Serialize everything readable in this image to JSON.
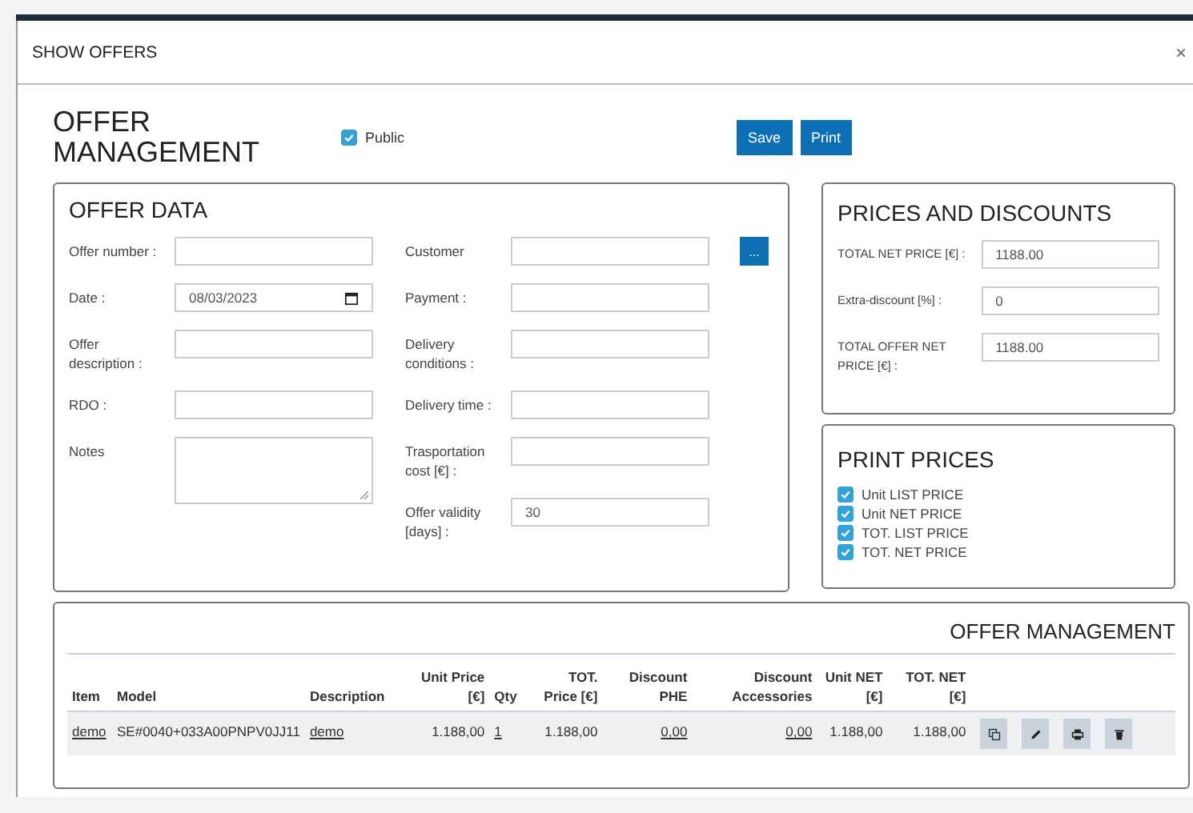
{
  "dialog": {
    "title": "SHOW OFFERS",
    "close": "×"
  },
  "header": {
    "title": "OFFER MANAGEMENT",
    "public": {
      "label": "Public",
      "checked": true
    },
    "buttons": [
      "Save",
      "Print"
    ]
  },
  "offer_data": {
    "title": "OFFER DATA",
    "customer_button": "...",
    "left_fields": [
      {
        "label": "Offer number :",
        "kind": "text"
      },
      {
        "label": "Date :",
        "kind": "date",
        "value": "08/03/2023"
      },
      {
        "label": "Offer description :",
        "kind": "text"
      },
      {
        "label": "RDO :",
        "kind": "text"
      },
      {
        "label": "Notes",
        "kind": "textarea"
      }
    ],
    "right_fields": [
      {
        "label": "Customer",
        "kind": "text"
      },
      {
        "label": "Payment :",
        "kind": "text"
      },
      {
        "label": "Delivery conditions :",
        "kind": "text"
      },
      {
        "label": "Delivery time :",
        "kind": "text"
      },
      {
        "label": "Trasportation cost [€] :",
        "kind": "text"
      },
      {
        "label": "Offer validity [days] :",
        "kind": "text",
        "value": "30"
      }
    ]
  },
  "prices": {
    "title": "PRICES AND DISCOUNTS",
    "fields": [
      {
        "label": "TOTAL NET PRICE [€] :",
        "value": "1188.00"
      },
      {
        "label": "Extra-discount [%] :",
        "value": "0"
      },
      {
        "label": "TOTAL OFFER NET PRICE [€] :",
        "value": "1188.00"
      }
    ]
  },
  "print_prices": {
    "title": "PRINT PRICES",
    "options": [
      {
        "label": "Unit LIST PRICE",
        "checked": true
      },
      {
        "label": "Unit NET PRICE",
        "checked": true
      },
      {
        "label": "TOT. LIST PRICE",
        "checked": true
      },
      {
        "label": "TOT. NET PRICE",
        "checked": true
      }
    ]
  },
  "table": {
    "title": "OFFER MANAGEMENT",
    "columns": [
      "Item",
      "Model",
      "Description",
      "Unit Price [€]",
      "Qty",
      "TOT. Price [€]",
      "Discount PHE",
      "Discount Accessories",
      "Unit NET [€]",
      "TOT. NET [€]"
    ],
    "rows": [
      {
        "cells": [
          {
            "text": "demo",
            "kind": "link"
          },
          {
            "text": "SE#0040+033A00PNPV0JJ11",
            "kind": "text"
          },
          {
            "text": "demo",
            "kind": "link"
          },
          {
            "text": "1.188,00",
            "kind": "text"
          },
          {
            "text": "1",
            "kind": "link"
          },
          {
            "text": "1.188,00",
            "kind": "text"
          },
          {
            "text": "0,00",
            "kind": "link"
          },
          {
            "text": "0,00",
            "kind": "link"
          },
          {
            "text": "1.188,00",
            "kind": "text"
          },
          {
            "text": "1.188,00",
            "kind": "text"
          }
        ]
      }
    ]
  }
}
